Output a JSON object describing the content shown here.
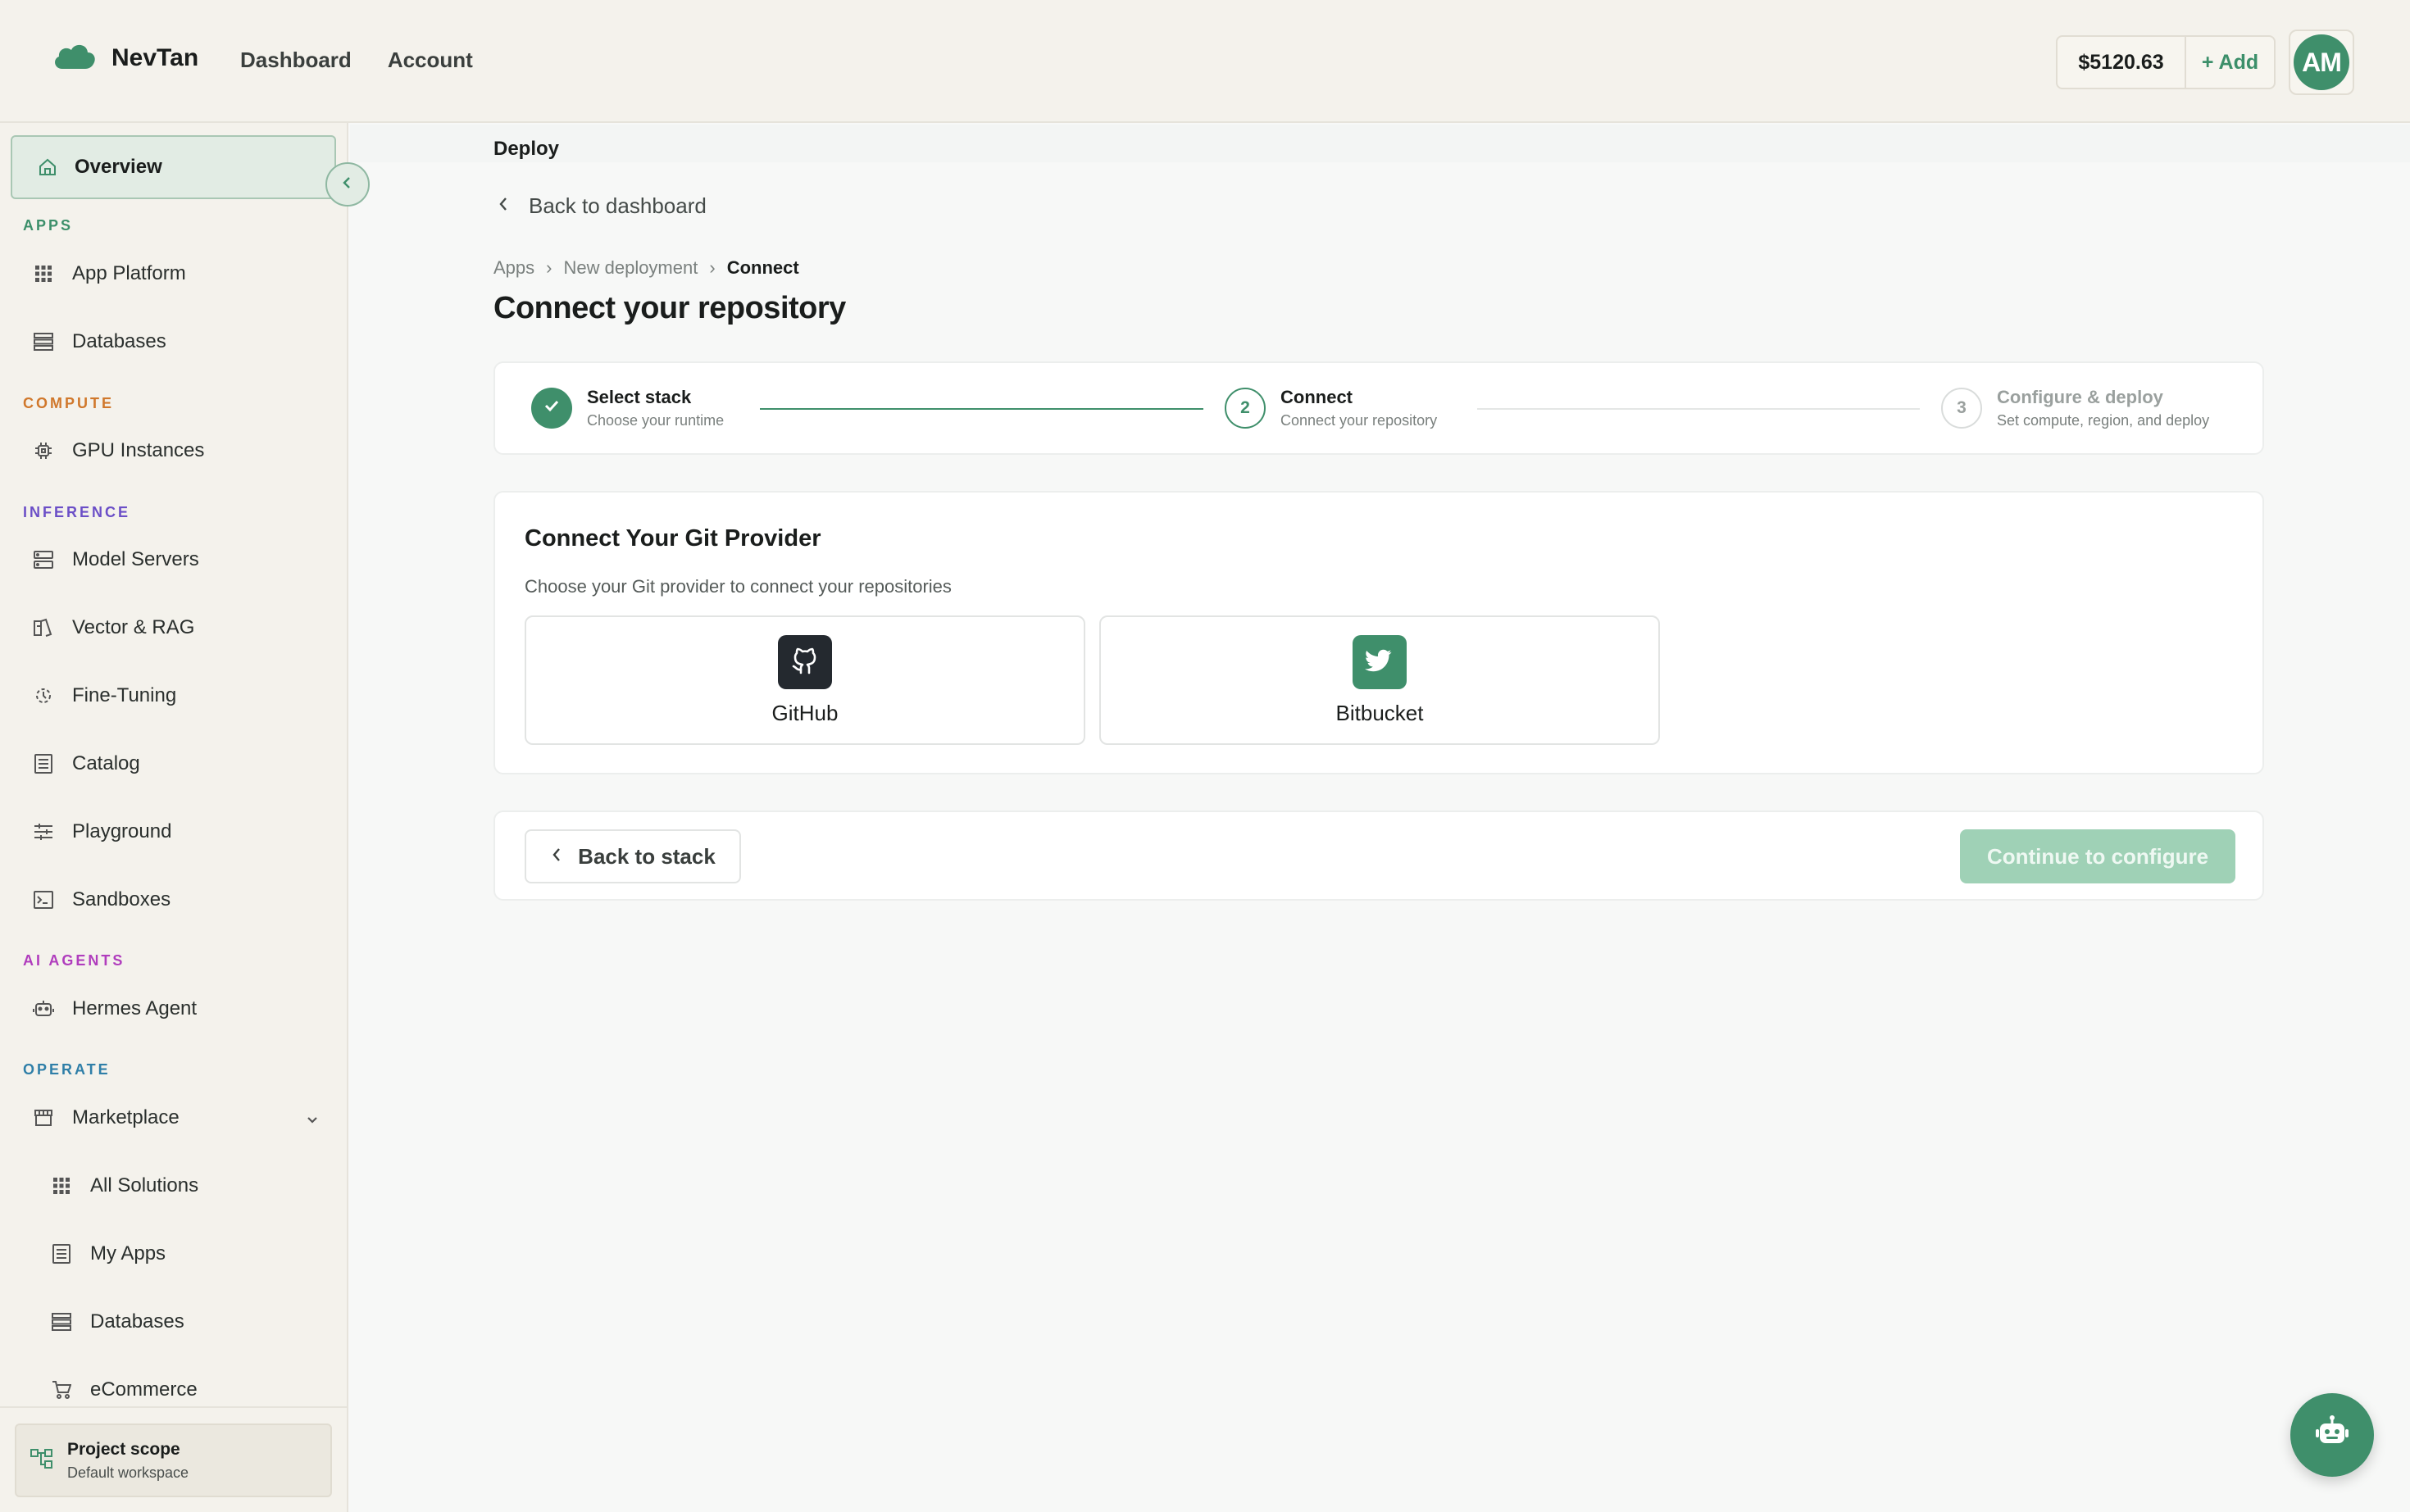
{
  "header": {
    "brand_name": "NevTan",
    "nav": [
      "Dashboard",
      "Account"
    ],
    "balance": "$5120.63",
    "add_label": "+ Add",
    "avatar_initials": "AM"
  },
  "sidebar": {
    "overview_label": "Overview",
    "sections": {
      "apps": {
        "title": "APPS",
        "color": "#3c8f6a",
        "items": [
          "App Platform",
          "Databases"
        ]
      },
      "compute": {
        "title": "COMPUTE",
        "color": "#d0782c",
        "items": [
          "GPU Instances"
        ]
      },
      "inference": {
        "title": "INFERENCE",
        "color": "#6b4fc7",
        "items": [
          "Model Servers",
          "Vector & RAG",
          "Fine-Tuning",
          "Catalog",
          "Playground",
          "Sandboxes"
        ]
      },
      "ai_agents": {
        "title": "AI AGENTS",
        "color": "#b03dbd",
        "items": [
          "Hermes Agent"
        ]
      },
      "operate": {
        "title": "OPERATE",
        "color": "#2f7fa8",
        "items": [
          "Marketplace"
        ],
        "subitems": [
          "All Solutions",
          "My Apps",
          "Databases",
          "eCommerce"
        ]
      }
    },
    "scope": {
      "title": "Project scope",
      "subtitle": "Default workspace"
    }
  },
  "main": {
    "section_title": "Deploy",
    "back_link": "Back to dashboard",
    "breadcrumb": [
      "Apps",
      "New deployment",
      "Connect"
    ],
    "page_title": "Connect your repository",
    "steps": [
      {
        "number": "1",
        "label": "Select stack",
        "sub": "Choose your runtime",
        "state": "done"
      },
      {
        "number": "2",
        "label": "Connect",
        "sub": "Connect your repository",
        "state": "active"
      },
      {
        "number": "3",
        "label": "Configure & deploy",
        "sub": "Set compute, region, and deploy",
        "state": "pending"
      }
    ],
    "provider": {
      "title": "Connect Your Git Provider",
      "subtitle": "Choose your Git provider to connect your repositories",
      "options": [
        {
          "name": "GitHub",
          "icon": "github-icon",
          "color": "#24292f"
        },
        {
          "name": "Bitbucket",
          "icon": "bird-icon",
          "color": "#3f8f6b"
        }
      ]
    },
    "footer": {
      "back_label": "Back to stack",
      "continue_label": "Continue to configure"
    }
  },
  "colors": {
    "accent": "#3f8f6b",
    "accent_light": "#9fd1b6"
  }
}
